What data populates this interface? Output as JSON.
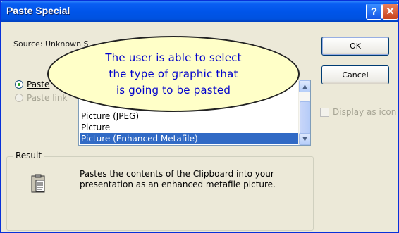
{
  "window": {
    "title": "Paste Special",
    "help_glyph": "?",
    "close_glyph": "✕"
  },
  "source": {
    "text": "Source:  Unknown S"
  },
  "buttons": {
    "ok": "OK",
    "cancel": "Cancel"
  },
  "options": {
    "paste": {
      "label": "Paste",
      "selected": true
    },
    "paste_link": {
      "label": "Paste link",
      "selected": false,
      "enabled": false
    }
  },
  "list": {
    "items": [
      "Picture (JPEG)",
      "Picture",
      "Picture (Enhanced Metafile)"
    ],
    "selected_index": 2
  },
  "display_as_icon": {
    "label": "Display as icon",
    "checked": false,
    "enabled": false
  },
  "result": {
    "legend": "Result",
    "description": "Pastes the contents of the Clipboard into your presentation as an enhanced metafile picture."
  },
  "callout": {
    "lines": [
      "The user is able to select",
      "the type of graphic that",
      "is going to be pasted"
    ]
  },
  "colors": {
    "titlebar": "#0055ea",
    "dialog_bg": "#ece9d8",
    "selection": "#316ac5",
    "callout_bg": "#ffffc8",
    "callout_text": "#0000cc"
  }
}
